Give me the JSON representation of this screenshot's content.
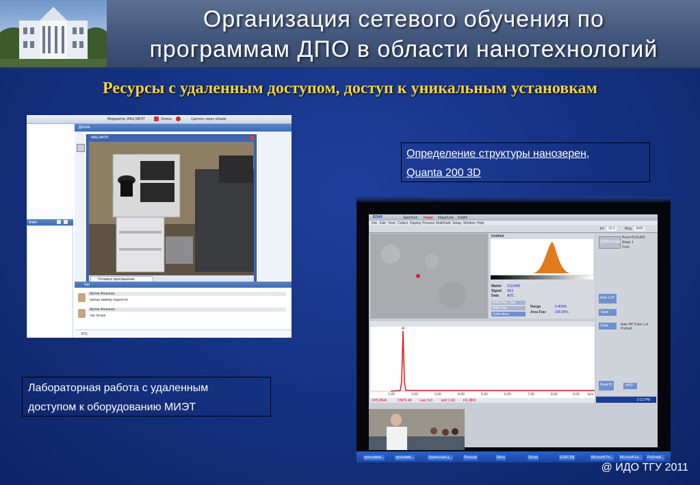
{
  "slide": {
    "title_line1": "Организация сетевого обучения по",
    "title_line2": "программам ДПО в области нанотехнологий",
    "subtitle": "Ресурсы с удаленным доступом, доступ к уникальным установкам",
    "caption_left_line1": "Лабораторная работа с удаленным",
    "caption_left_line2": "доступом к оборудованию МИЭТ",
    "caption_right_line1": "Определение структуры нанозерен,",
    "caption_right_line2": "Quanta 200 3D",
    "copyright": "@ ИДО ТГУ 2011"
  },
  "webinar": {
    "toolbar_moderator": "Модератор: ИАЦ МИЭТ",
    "toolbar_record": "Запись",
    "toolbar_share": "Сделать экран общим",
    "board_label": "Доска",
    "video_title": "ИАЦ МИЭТ",
    "invite_button": "Отозвать приглашение",
    "files_label": "Файл",
    "chat_label": "Чат",
    "chat_messages": [
      {
        "author": "Артем Фешенко",
        "text": "проще камеру поднести"
      },
      {
        "author": "Артем Фешенко",
        "text": "так лучше"
      }
    ],
    "chat_input_label": "RTL"
  },
  "edax": {
    "logo": "EDAX",
    "tabs": [
      "Spectrum",
      "Image",
      "Maps/Line",
      "Delphi"
    ],
    "menu": [
      "File",
      "Edit",
      "View",
      "Collect",
      "Display",
      "Process",
      "MultiField",
      "Setup",
      "Window",
      "Help"
    ],
    "kv_label": "kV",
    "kv_value": "20.0",
    "mag_label": "Mag",
    "mag_value": "3000",
    "image_title": "Untitled",
    "matrix_label": "Matrix",
    "matrix_value": "512x400",
    "signal_label": "Signal",
    "signal_value": "SE1",
    "data_label": "Data",
    "data_value": "ADC",
    "build_button": "Build Mon. Sav",
    "build_button2": "Build Sav",
    "color_area_button": "Color Area",
    "range_label": "Range",
    "range_value": "0-409%",
    "area_frac_label": "Area Frac",
    "area_frac_value": "100.00%",
    "collect_button": "Collect Image",
    "reso_label": "Reso=512x400",
    "steps_label": "Steps 1",
    "cont_label": "Cont.",
    "auto_button": "Auto LUT",
    "save_button": "Save",
    "print_button": "Print",
    "auto_options": "Auto HP Color Lot Portrait",
    "peak_button": "Peak ID",
    "hpd_button": "HPD",
    "spectrum_peak_label": "Al",
    "status_cps": "CPS 8641",
    "status_cnts": "CNTS 40",
    "status_kev": "keV 1.60",
    "status_lsec": "Lsec 9.3",
    "status_res": "FS 3801",
    "spectrum_ticks": [
      "1.00",
      "2.00",
      "3.00",
      "4.00",
      "5.00",
      "6.00",
      "7.00",
      "8.00",
      "9.00"
    ],
    "spectrum_unit": "keV",
    "taskbar_items": [
      "программн...",
      "программ...",
      "Удаленный д...",
      "Posuvaz",
      "Rena",
      "Sonsa",
      "EDAX [N]",
      "Microsoft Po...",
      "Microsoft Ex...",
      "Рабочий..."
    ],
    "clock": "2:12 PM"
  },
  "colors": {
    "title_text": "#ffffff",
    "subtitle_text": "#f3d33c",
    "slide_bg": "#14307f",
    "header_bg": "#4a5e82",
    "spectrum_peak": "#e02020",
    "histogram": "#e07a1e"
  }
}
